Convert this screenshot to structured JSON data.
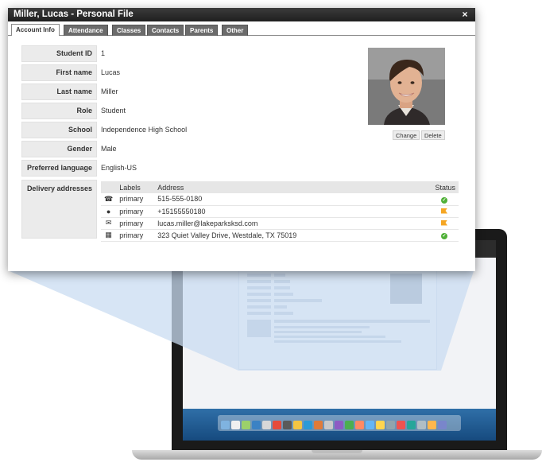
{
  "dialog": {
    "title": "Miller, Lucas - Personal File",
    "close_glyph": "×",
    "tabs": [
      "Account Info",
      "Attendance",
      "Classes",
      "Contacts",
      "Parents",
      "Other"
    ],
    "active_tab": "Account Info"
  },
  "fields": [
    {
      "label": "Student ID",
      "value": "1"
    },
    {
      "label": "First name",
      "value": "Lucas"
    },
    {
      "label": "Last name",
      "value": "Miller"
    },
    {
      "label": "Role",
      "value": "Student"
    },
    {
      "label": "School",
      "value": "Independence High School"
    },
    {
      "label": "Gender",
      "value": "Male"
    },
    {
      "label": "Preferred language",
      "value": "English-US"
    }
  ],
  "photo": {
    "change_label": "Change",
    "delete_label": "Delete"
  },
  "delivery": {
    "label": "Delivery addresses",
    "headers": {
      "labels": "Labels",
      "address": "Address",
      "status": "Status"
    },
    "rows": [
      {
        "icon": "phone-icon",
        "glyph": "☎",
        "label": "primary",
        "address": "515-555-0180",
        "status": "ok"
      },
      {
        "icon": "chat-bubble-icon",
        "glyph": "●",
        "label": "primary",
        "address": "+15155550180",
        "status": "flag"
      },
      {
        "icon": "envelope-icon",
        "glyph": "✉",
        "label": "primary",
        "address": "lucas.miller@lakeparksksd.com",
        "status": "flag"
      },
      {
        "icon": "building-icon",
        "glyph": "▦",
        "label": "primary",
        "address": "323 Quiet Valley Drive, Westdale, TX 75019",
        "status": "ok"
      }
    ]
  },
  "colors": {
    "titlebar": "#2a2a2a",
    "tab_inactive": "#6b6b6b",
    "status_ok": "#4fb037",
    "status_flag": "#f5a623",
    "beam": "#c9dcf2"
  }
}
